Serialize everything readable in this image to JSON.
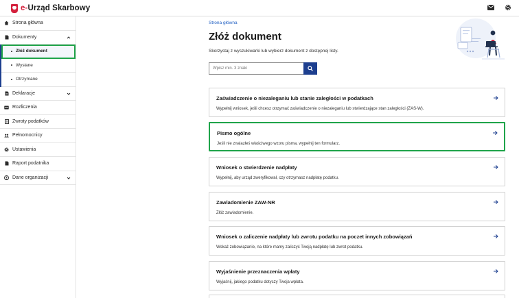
{
  "app": {
    "title_prefix": "e-",
    "title_rest": "Urząd Skarbowy"
  },
  "sidebar": {
    "items": [
      {
        "label": "Strona główna",
        "icon": "home-icon"
      },
      {
        "label": "Dokumenty",
        "icon": "document-icon"
      },
      {
        "label": "Deklaracje",
        "icon": "declaration-icon"
      },
      {
        "label": "Rozliczenia",
        "icon": "settlement-icon"
      },
      {
        "label": "Zwroty podatków",
        "icon": "refund-icon"
      },
      {
        "label": "Pełnomocnicy",
        "icon": "people-icon"
      },
      {
        "label": "Ustawienia",
        "icon": "gear-icon"
      },
      {
        "label": "Raport podatnika",
        "icon": "report-icon"
      },
      {
        "label": "Dane organizacji",
        "icon": "organization-icon"
      }
    ],
    "sub_items": [
      {
        "label": "Złóż dokument"
      },
      {
        "label": "Wysłane"
      },
      {
        "label": "Otrzymane"
      }
    ]
  },
  "main": {
    "breadcrumb": "Strona główna",
    "title": "Złóż dokument",
    "subtitle": "Skorzystaj z wyszukiwarki lub wybierz dokument z dostępnej listy.",
    "search_placeholder": "Wpisz min. 3 znaki",
    "cards": [
      {
        "title": "Zaświadczenie o niezaleganiu lub stanie zaległości w podatkach",
        "description": "Wypełnij wniosek, jeśli chcesz otrzymać zaświadczenie o niezaleganiu lub stwierdzające stan zaległości (ZAS-W)."
      },
      {
        "title": "Pismo ogólne",
        "description": "Jeśli nie znalazłeś właściwego wzoru pisma, wypełnij ten formularz."
      },
      {
        "title": "Wniosek o stwierdzenie nadpłaty",
        "description": "Wypełnij, aby urząd zweryfikował, czy otrzymasz nadpłatę podatku."
      },
      {
        "title": "Zawiadomienie ZAW-NR",
        "description": "Złóż zawiadomienie."
      },
      {
        "title": "Wniosek o zaliczenie nadpłaty lub zwrotu podatku na poczet innych zobowiązań",
        "description": "Wskaż zobowiązanie, na które mamy zaliczyć Twoją nadpłatę lub zwrot podatku."
      },
      {
        "title": "Wyjaśnienie przeznaczenia wpłaty",
        "description": "Wyjaśnij, jakiego podatku dotyczy Twoja wpłata."
      }
    ]
  },
  "colors": {
    "brand_red": "#d4213d",
    "navy": "#1d3f8f",
    "link_blue": "#1d5dc2",
    "highlight_green": "#1fa44a"
  }
}
